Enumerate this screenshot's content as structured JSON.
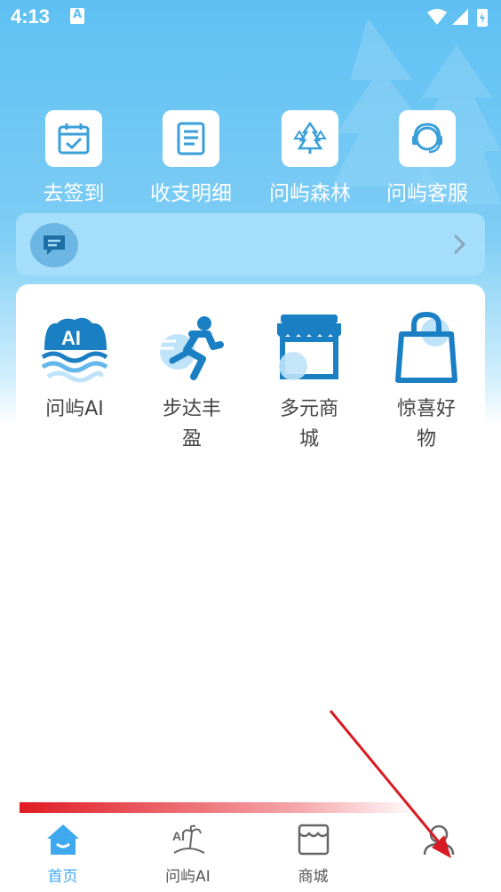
{
  "status_bar": {
    "time": "4:13",
    "notif_badge": "A"
  },
  "quick_actions": [
    {
      "label": "去签到",
      "icon": "calendar-check-icon"
    },
    {
      "label": "收支明细",
      "icon": "document-list-icon"
    },
    {
      "label": "问屿森林",
      "icon": "forest-icon"
    },
    {
      "label": "问屿客服",
      "icon": "customer-service-icon"
    }
  ],
  "message_bar": {
    "icon": "message-icon"
  },
  "services": [
    {
      "label": "问屿AI",
      "icon": "ai-wave-icon"
    },
    {
      "label": "步达丰盈",
      "icon": "running-man-icon"
    },
    {
      "label": "多元商城",
      "icon": "store-icon"
    },
    {
      "label": "惊喜好物",
      "icon": "shopping-bag-icon"
    }
  ],
  "bottom_nav": [
    {
      "label": "首页",
      "icon": "home-icon",
      "active": true
    },
    {
      "label": "问屿AI",
      "icon": "ai-island-icon",
      "active": false
    },
    {
      "label": "商城",
      "icon": "shop-icon",
      "active": false
    },
    {
      "label": "",
      "icon": "profile-icon",
      "active": false
    }
  ],
  "colors": {
    "primary": "#3fa9f0",
    "hero": "#5fc0f3",
    "arrow": "#d61c22"
  }
}
